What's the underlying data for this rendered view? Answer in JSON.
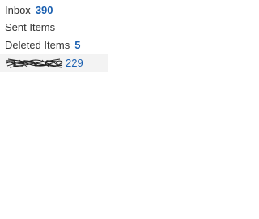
{
  "folders": [
    {
      "label": "Inbox",
      "count": "390"
    },
    {
      "label": "Sent Items",
      "count": ""
    },
    {
      "label": "Deleted Items",
      "count": "5"
    },
    {
      "label": "",
      "count": "229"
    }
  ],
  "colors": {
    "count_text": "#1a5fb0",
    "label_text": "#333333",
    "selected_bg": "#f3f3f3"
  }
}
